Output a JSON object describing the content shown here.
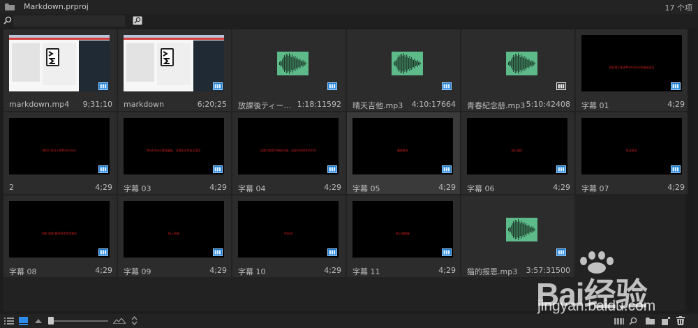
{
  "header": {
    "title": "Markdown.prproj",
    "item_count": "17 个项"
  },
  "search": {
    "value": "",
    "placeholder": ""
  },
  "items": [
    {
      "name": "markdown.mp4",
      "duration": "9;31;10",
      "kind": "screenshot",
      "caption": "",
      "selected": false
    },
    {
      "name": "markdown",
      "duration": "6;20;25",
      "kind": "screenshot",
      "caption": "",
      "selected": false
    },
    {
      "name": "放課後ティー…",
      "duration": "1:18:11592",
      "kind": "audio",
      "caption": "",
      "selected": false
    },
    {
      "name": "晴天吉他.mp3",
      "duration": "4:10:17664",
      "kind": "audio",
      "caption": "",
      "selected": false
    },
    {
      "name": "青春紀念册.mp3",
      "duration": "5:10:42408",
      "kind": "audio",
      "caption": "",
      "selected": false,
      "badge": "white"
    },
    {
      "name": "字幕 01",
      "duration": "4;29",
      "kind": "title",
      "caption": "现在我们来讲Markdown的基础语法",
      "selected": false
    },
    {
      "name": "2",
      "duration": "4;29",
      "kind": "title",
      "caption": "首先介绍什么是Markdown",
      "selected": false
    },
    {
      "name": "字幕 03",
      "duration": "4;29",
      "kind": "title",
      "caption": "Markdown是轻量级，可视化文件标记语言",
      "selected": false
    },
    {
      "name": "字幕 04",
      "duration": "4;29",
      "kind": "title",
      "caption": "这就为其帮写带来方便，也成为你如学的书写",
      "selected": false
    },
    {
      "name": "字幕 05",
      "duration": "4;29",
      "kind": "title",
      "caption": "最新版本",
      "selected": true
    },
    {
      "name": "字幕 06",
      "duration": "4;29",
      "kind": "title",
      "caption": "插入图片",
      "selected": false
    },
    {
      "name": "字幕 07",
      "duration": "4;29",
      "kind": "title",
      "caption": "标注格式",
      "selected": false
    },
    {
      "name": "字幕 08",
      "duration": "4;29",
      "kind": "title",
      "caption": "加粗 斜体 删除线等常用格式",
      "selected": false
    },
    {
      "name": "字幕 09",
      "duration": "4;29",
      "kind": "title",
      "caption": "插入表格",
      "selected": false
    },
    {
      "name": "字幕 10",
      "duration": "4;29",
      "kind": "title",
      "caption": "代码块",
      "selected": false
    },
    {
      "name": "字幕 11",
      "duration": "4;29",
      "kind": "title",
      "caption": "插入超链接",
      "selected": false
    },
    {
      "name": "猫的报恩.mp3",
      "duration": "3:57:31500",
      "kind": "audio",
      "caption": "",
      "selected": false
    }
  ],
  "footer": {
    "zoom_level": 0.05
  },
  "watermark": {
    "brand": "Bai经验",
    "url": "jingyan.baidu.com"
  },
  "colors": {
    "accent": "#1c7fd6",
    "caption_red": "#d21f1f",
    "audio_green": "#5dbb8a",
    "panel_bg": "#1d1d1d"
  }
}
